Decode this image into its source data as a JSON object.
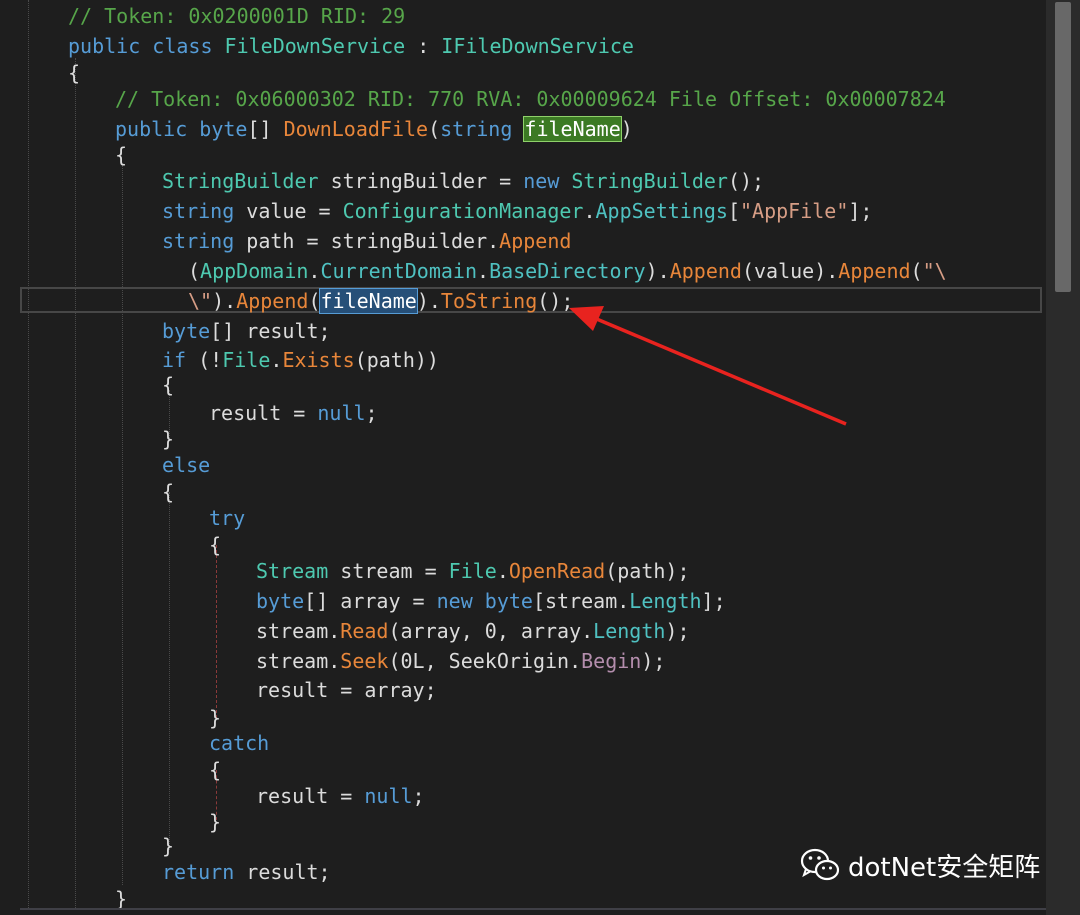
{
  "editor": {
    "lines": [
      [
        [
          "cm",
          "// Token: 0x0200001D RID: 29"
        ]
      ],
      [
        [
          "kw",
          "public class "
        ],
        [
          "ty",
          "FileDownService"
        ],
        [
          "pl",
          " : "
        ],
        [
          "ty",
          "IFileDownService"
        ]
      ],
      [
        [
          "pl",
          "{"
        ]
      ],
      [
        [
          "cm",
          "// Token: 0x06000302 RID: 770 RVA: 0x00009624 File Offset: 0x00007824"
        ]
      ],
      [
        [
          "kw",
          "public byte"
        ],
        [
          "pl",
          "[] "
        ],
        [
          "me",
          "DownLoadFile"
        ],
        [
          "pl",
          "("
        ],
        [
          "kw",
          "string "
        ],
        [
          "hl-green",
          "fileName"
        ],
        [
          "pl",
          ")"
        ]
      ],
      [
        [
          "pl",
          "{"
        ]
      ],
      [
        [
          "ty",
          "StringBuilder"
        ],
        [
          "pl",
          " stringBuilder = "
        ],
        [
          "kw",
          "new "
        ],
        [
          "ty",
          "StringBuilder"
        ],
        [
          "pl",
          "();"
        ]
      ],
      [
        [
          "kw",
          "string"
        ],
        [
          "pl",
          " value = "
        ],
        [
          "ty",
          "ConfigurationManager"
        ],
        [
          "pl",
          "."
        ],
        [
          "pr",
          "AppSettings"
        ],
        [
          "pl",
          "["
        ],
        [
          "st",
          "\"AppFile\""
        ],
        [
          "pl",
          "];"
        ]
      ],
      [
        [
          "kw",
          "string"
        ],
        [
          "pl",
          " path = stringBuilder."
        ],
        [
          "me",
          "Append"
        ]
      ],
      [
        [
          "pl",
          "("
        ],
        [
          "ty",
          "AppDomain"
        ],
        [
          "pl",
          "."
        ],
        [
          "pr",
          "CurrentDomain"
        ],
        [
          "pl",
          "."
        ],
        [
          "pr",
          "BaseDirectory"
        ],
        [
          "pl",
          ")."
        ],
        [
          "me",
          "Append"
        ],
        [
          "pl",
          "(value)."
        ],
        [
          "me",
          "Append"
        ],
        [
          "pl",
          "("
        ],
        [
          "st",
          "\"\\"
        ]
      ],
      [
        [
          "st",
          "\\\""
        ],
        [
          "pl",
          ")."
        ],
        [
          "me",
          "Append"
        ],
        [
          "pl",
          "("
        ],
        [
          "hl-blue",
          "fileName"
        ],
        [
          "pl",
          ")."
        ],
        [
          "me",
          "ToString"
        ],
        [
          "pl",
          "();"
        ]
      ],
      [
        [
          "kw",
          "byte"
        ],
        [
          "pl",
          "[] result;"
        ]
      ],
      [
        [
          "kw",
          "if"
        ],
        [
          "pl",
          " (!"
        ],
        [
          "ty",
          "File"
        ],
        [
          "pl",
          "."
        ],
        [
          "me",
          "Exists"
        ],
        [
          "pl",
          "(path))"
        ]
      ],
      [
        [
          "pl",
          "{"
        ]
      ],
      [
        [
          "pl",
          "result = "
        ],
        [
          "kw",
          "null"
        ],
        [
          "pl",
          ";"
        ]
      ],
      [
        [
          "pl",
          "}"
        ]
      ],
      [
        [
          "kw",
          "else"
        ]
      ],
      [
        [
          "pl",
          "{"
        ]
      ],
      [
        [
          "kw",
          "try"
        ]
      ],
      [
        [
          "pl",
          "{"
        ]
      ],
      [
        [
          "ty",
          "Stream"
        ],
        [
          "pl",
          " stream = "
        ],
        [
          "ty",
          "File"
        ],
        [
          "pl",
          "."
        ],
        [
          "me",
          "OpenRead"
        ],
        [
          "pl",
          "(path);"
        ]
      ],
      [
        [
          "kw",
          "byte"
        ],
        [
          "pl",
          "[] array = "
        ],
        [
          "kw",
          "new byte"
        ],
        [
          "pl",
          "[stream."
        ],
        [
          "pr",
          "Length"
        ],
        [
          "pl",
          "];"
        ]
      ],
      [
        [
          "pl",
          "stream."
        ],
        [
          "me",
          "Read"
        ],
        [
          "pl",
          "(array, 0, array."
        ],
        [
          "pr",
          "Length"
        ],
        [
          "pl",
          ");"
        ]
      ],
      [
        [
          "pl",
          "stream."
        ],
        [
          "me",
          "Seek"
        ],
        [
          "pl",
          "(0L, SeekOrigin."
        ],
        [
          "pp",
          "Begin"
        ],
        [
          "pl",
          ");"
        ]
      ],
      [
        [
          "pl",
          "result = array;"
        ]
      ],
      [
        [
          "pl",
          "}"
        ]
      ],
      [
        [
          "kw",
          "catch"
        ]
      ],
      [
        [
          "pl",
          "{"
        ]
      ],
      [
        [
          "pl",
          "result = "
        ],
        [
          "kw",
          "null"
        ],
        [
          "pl",
          ";"
        ]
      ],
      [
        [
          "pl",
          "}"
        ]
      ],
      [
        [
          "pl",
          "}"
        ]
      ],
      [
        [
          "kw",
          "return"
        ],
        [
          "pl",
          " result;"
        ]
      ],
      [
        [
          "pl",
          "}"
        ]
      ]
    ]
  },
  "watermark": {
    "icon": "wechat-icon",
    "text": "dotNet安全矩阵"
  },
  "annotation": {
    "color": "#e8231f",
    "icon": "red-arrow-icon"
  }
}
